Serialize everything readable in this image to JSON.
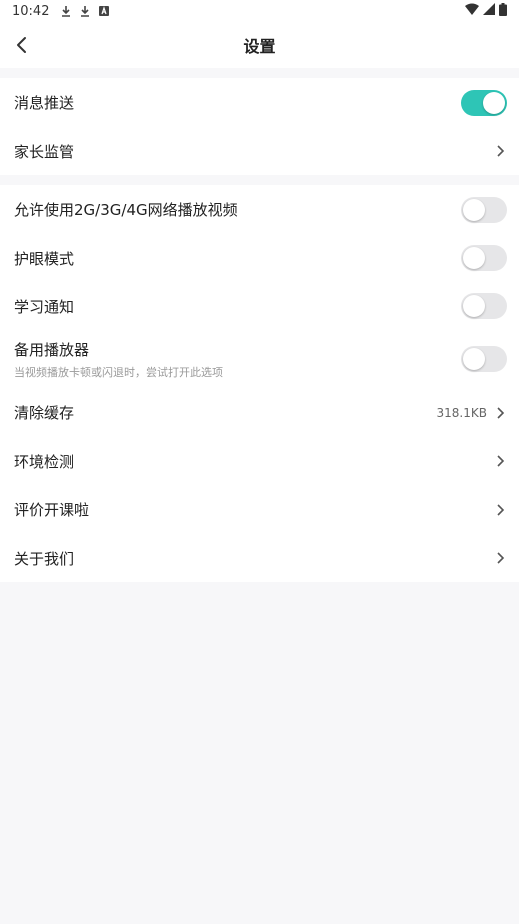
{
  "status_bar": {
    "time": "10:42"
  },
  "header": {
    "title": "设置"
  },
  "group1": [
    {
      "label": "消息推送",
      "toggle": true
    },
    {
      "label": "家长监管"
    }
  ],
  "group2": [
    {
      "label": "允许使用2G/3G/4G网络播放视频",
      "toggle": false
    },
    {
      "label": "护眼模式",
      "toggle": false
    },
    {
      "label": "学习通知",
      "toggle": false
    },
    {
      "label": "备用播放器",
      "subtext": "当视频播放卡顿或闪退时，尝试打开此选项",
      "toggle": false
    },
    {
      "label": "清除缓存",
      "value": "318.1KB"
    },
    {
      "label": "环境检测"
    },
    {
      "label": "评价开课啦"
    },
    {
      "label": "关于我们"
    }
  ],
  "colors": {
    "accent": "#2ec5b6",
    "toggle_off": "#e6e6e8",
    "background": "#f7f7f9"
  }
}
